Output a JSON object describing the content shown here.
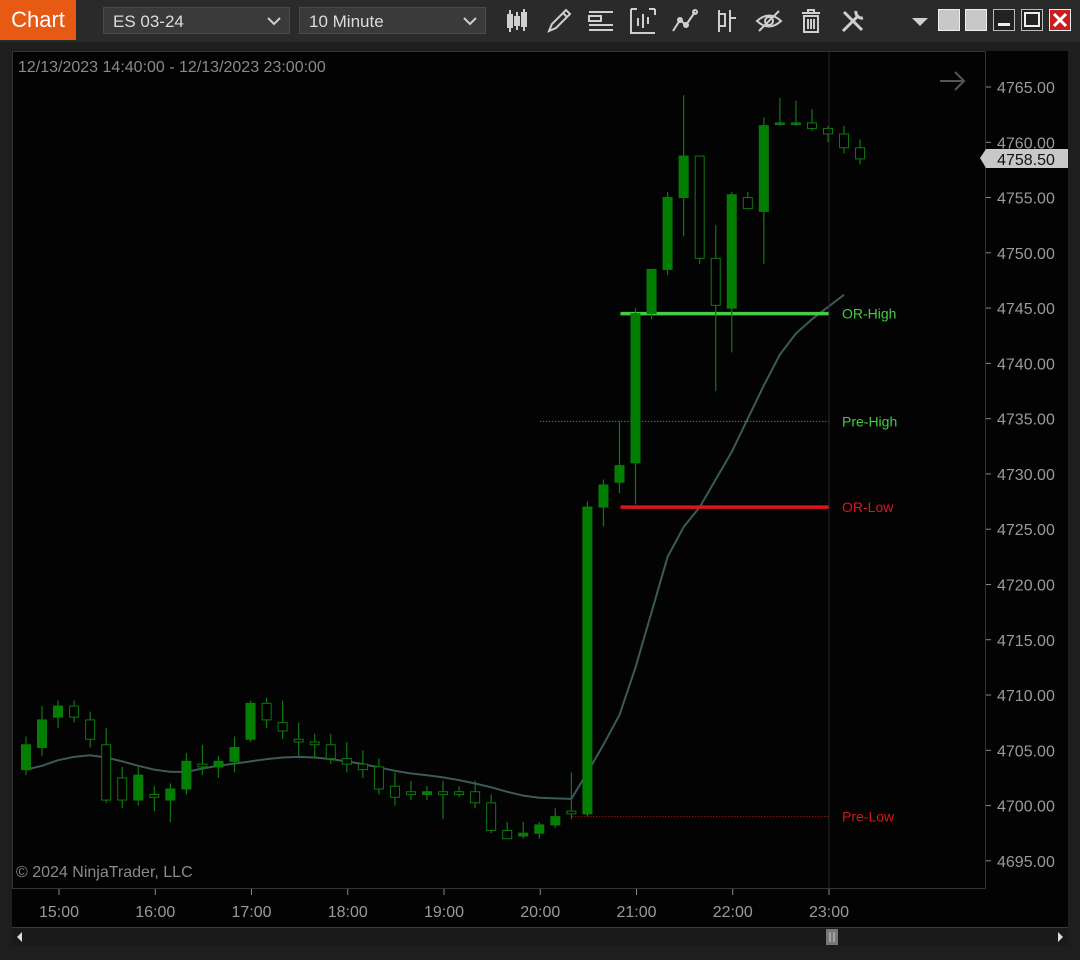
{
  "toolbar": {
    "tab_label": "Chart",
    "instrument": "ES 03-24",
    "interval": "10 Minute",
    "tools": [
      "bar-type-icon",
      "drawing-tool-icon",
      "chart-properties-icon",
      "data-series-icon",
      "indicators-icon",
      "strategies-icon",
      "show-hide-icon",
      "clear-icon",
      "settings-icon"
    ],
    "window_controls": [
      "dropdown-icon",
      "tile-icon",
      "tile-icon",
      "minimize-icon",
      "maximize-icon",
      "close-icon"
    ]
  },
  "chart": {
    "date_range": "12/13/2023 14:40:00 - 12/13/2023 23:00:00",
    "copyright": "© 2024 NinjaTrader, LLC",
    "last_price_label": "4758.50",
    "colors": {
      "up": "#007f00",
      "down": "#000000",
      "wick": "#0e7a0e",
      "sma": "#3c5a5a",
      "or_high": "#44cc44",
      "or_low": "#e0141e",
      "pre_high": "#44cc44",
      "pre_low": "#d01818"
    }
  },
  "chart_data": {
    "type": "candlestick",
    "symbol": "ES 03-24",
    "interval": "10 Minute",
    "x_ticks": [
      "15:00",
      "16:00",
      "17:00",
      "18:00",
      "19:00",
      "20:00",
      "21:00",
      "22:00",
      "23:00"
    ],
    "y_ticks": [
      "4765.00",
      "4760.00",
      "4755.00",
      "4750.00",
      "4745.00",
      "4740.00",
      "4735.00",
      "4730.00",
      "4725.00",
      "4720.00",
      "4715.00",
      "4710.00",
      "4705.00",
      "4700.00",
      "4695.00"
    ],
    "ylim": [
      4692.5,
      4767.5
    ],
    "times": [
      "14:40",
      "14:50",
      "15:00",
      "15:10",
      "15:20",
      "15:30",
      "15:40",
      "15:50",
      "16:00",
      "16:10",
      "16:20",
      "16:30",
      "16:40",
      "16:50",
      "17:00",
      "17:10",
      "17:20",
      "17:30",
      "17:40",
      "17:50",
      "18:00",
      "18:10",
      "18:20",
      "18:30",
      "18:40",
      "18:50",
      "19:00",
      "19:10",
      "19:20",
      "19:30",
      "19:40",
      "19:50",
      "20:00",
      "20:10",
      "20:20",
      "20:30",
      "20:40",
      "20:50",
      "21:00",
      "21:10",
      "21:20",
      "21:30",
      "21:40",
      "21:50",
      "22:00",
      "22:10",
      "22:20",
      "22:30",
      "22:40",
      "22:50",
      "23:00"
    ],
    "candles": [
      {
        "o": 4703.25,
        "h": 4706.25,
        "l": 4702.75,
        "c": 4705.5
      },
      {
        "o": 4705.25,
        "h": 4709.0,
        "l": 4704.5,
        "c": 4707.75
      },
      {
        "o": 4708.0,
        "h": 4709.5,
        "l": 4707.0,
        "c": 4709.0
      },
      {
        "o": 4709.0,
        "h": 4709.5,
        "l": 4707.5,
        "c": 4708.0
      },
      {
        "o": 4707.75,
        "h": 4708.5,
        "l": 4705.25,
        "c": 4706.0
      },
      {
        "o": 4705.5,
        "h": 4707.0,
        "l": 4700.25,
        "c": 4700.5
      },
      {
        "o": 4702.5,
        "h": 4703.5,
        "l": 4699.75,
        "c": 4700.5
      },
      {
        "o": 4700.5,
        "h": 4703.5,
        "l": 4700.0,
        "c": 4702.75
      },
      {
        "o": 4701.0,
        "h": 4701.75,
        "l": 4699.5,
        "c": 4700.75
      },
      {
        "o": 4700.5,
        "h": 4702.0,
        "l": 4698.5,
        "c": 4701.5
      },
      {
        "o": 4701.5,
        "h": 4704.75,
        "l": 4701.0,
        "c": 4704.0
      },
      {
        "o": 4703.75,
        "h": 4705.5,
        "l": 4702.75,
        "c": 4703.5
      },
      {
        "o": 4703.5,
        "h": 4704.5,
        "l": 4702.5,
        "c": 4704.0
      },
      {
        "o": 4704.0,
        "h": 4706.25,
        "l": 4703.0,
        "c": 4705.25
      },
      {
        "o": 4706.0,
        "h": 4709.5,
        "l": 4705.75,
        "c": 4709.25
      },
      {
        "o": 4709.25,
        "h": 4709.75,
        "l": 4707.0,
        "c": 4707.75
      },
      {
        "o": 4707.5,
        "h": 4709.5,
        "l": 4706.0,
        "c": 4706.75
      },
      {
        "o": 4706.0,
        "h": 4707.5,
        "l": 4704.5,
        "c": 4705.75
      },
      {
        "o": 4705.75,
        "h": 4706.5,
        "l": 4704.25,
        "c": 4705.5
      },
      {
        "o": 4705.5,
        "h": 4706.5,
        "l": 4703.75,
        "c": 4704.25
      },
      {
        "o": 4704.25,
        "h": 4705.75,
        "l": 4703.0,
        "c": 4703.75
      },
      {
        "o": 4703.75,
        "h": 4705.0,
        "l": 4702.5,
        "c": 4703.25
      },
      {
        "o": 4703.5,
        "h": 4704.25,
        "l": 4701.0,
        "c": 4701.5
      },
      {
        "o": 4701.75,
        "h": 4703.0,
        "l": 4700.0,
        "c": 4700.75
      },
      {
        "o": 4701.25,
        "h": 4702.25,
        "l": 4700.5,
        "c": 4701.0
      },
      {
        "o": 4701.0,
        "h": 4701.75,
        "l": 4700.5,
        "c": 4701.25
      },
      {
        "o": 4701.25,
        "h": 4702.25,
        "l": 4698.75,
        "c": 4701.0
      },
      {
        "o": 4701.25,
        "h": 4701.75,
        "l": 4700.75,
        "c": 4701.0
      },
      {
        "o": 4701.25,
        "h": 4702.25,
        "l": 4699.75,
        "c": 4700.25
      },
      {
        "o": 4700.25,
        "h": 4701.0,
        "l": 4697.5,
        "c": 4697.75
      },
      {
        "o": 4697.75,
        "h": 4698.5,
        "l": 4697.0,
        "c": 4697.0
      },
      {
        "o": 4697.25,
        "h": 4698.5,
        "l": 4697.0,
        "c": 4697.5
      },
      {
        "o": 4697.5,
        "h": 4698.5,
        "l": 4697.0,
        "c": 4698.25
      },
      {
        "o": 4698.25,
        "h": 4699.75,
        "l": 4698.0,
        "c": 4699.0
      },
      {
        "o": 4699.5,
        "h": 4703.0,
        "l": 4698.75,
        "c": 4699.25
      },
      {
        "o": 4699.25,
        "h": 4727.5,
        "l": 4699.0,
        "c": 4727.0
      },
      {
        "o": 4727.0,
        "h": 4729.5,
        "l": 4725.25,
        "c": 4729.0
      },
      {
        "o": 4729.25,
        "h": 4734.75,
        "l": 4728.25,
        "c": 4730.75
      },
      {
        "o": 4731.0,
        "h": 4745.0,
        "l": 4727.25,
        "c": 4744.5
      },
      {
        "o": 4744.5,
        "h": 4748.5,
        "l": 4744.0,
        "c": 4748.5
      },
      {
        "o": 4748.5,
        "h": 4755.5,
        "l": 4748.0,
        "c": 4755.0
      },
      {
        "o": 4755.0,
        "h": 4764.25,
        "l": 4751.5,
        "c": 4758.75
      },
      {
        "o": 4758.75,
        "h": 4758.75,
        "l": 4749.0,
        "c": 4749.5
      },
      {
        "o": 4749.5,
        "h": 4752.5,
        "l": 4737.5,
        "c": 4745.25
      },
      {
        "o": 4745.0,
        "h": 4755.5,
        "l": 4741.0,
        "c": 4755.25
      },
      {
        "o": 4755.0,
        "h": 4755.5,
        "l": 4754.0,
        "c": 4754.0
      },
      {
        "o": 4753.75,
        "h": 4762.25,
        "l": 4749.0,
        "c": 4761.5
      },
      {
        "o": 4761.75,
        "h": 4764.0,
        "l": 4761.5,
        "c": 4761.75
      },
      {
        "o": 4761.75,
        "h": 4763.75,
        "l": 4761.5,
        "c": 4761.75
      },
      {
        "o": 4761.75,
        "h": 4763.0,
        "l": 4761.0,
        "c": 4761.25
      },
      {
        "o": 4761.25,
        "h": 4761.5,
        "l": 4760.0,
        "c": 4760.75
      },
      {
        "o": 4760.75,
        "h": 4761.5,
        "l": 4759.0,
        "c": 4759.5
      },
      {
        "o": 4759.5,
        "h": 4760.25,
        "l": 4758.0,
        "c": 4758.5
      }
    ],
    "sma": [
      4703.25,
      4703.6,
      4704.1,
      4704.4,
      4704.55,
      4704.35,
      4704.0,
      4703.6,
      4703.25,
      4703.05,
      4703.05,
      4703.35,
      4703.6,
      4703.8,
      4704.0,
      4704.2,
      4704.35,
      4704.4,
      4704.35,
      4704.2,
      4704.0,
      4703.75,
      4703.45,
      4703.15,
      4702.9,
      4702.75,
      4702.55,
      4702.3,
      4702.0,
      4701.65,
      4701.25,
      4700.9,
      4700.7,
      4700.65,
      4700.6,
      4703.0,
      4705.5,
      4708.2,
      4712.5,
      4717.5,
      4722.5,
      4725.2,
      4727.0,
      4729.5,
      4732.0,
      4735.0,
      4738.0,
      4740.8,
      4742.7,
      4744.0,
      4745.1,
      4746.2
    ],
    "levels": [
      {
        "name": "OR-High",
        "price": 4744.5,
        "start_time": "20:50",
        "style": "solid"
      },
      {
        "name": "Pre-High",
        "price": 4734.75,
        "start_time": "20:00",
        "style": "dotted"
      },
      {
        "name": "OR-Low",
        "price": 4727.0,
        "start_time": "20:50",
        "style": "solid"
      },
      {
        "name": "Pre-Low",
        "price": 4699.0,
        "start_time": "20:20",
        "style": "dotted"
      }
    ],
    "last_price": 4758.5
  }
}
